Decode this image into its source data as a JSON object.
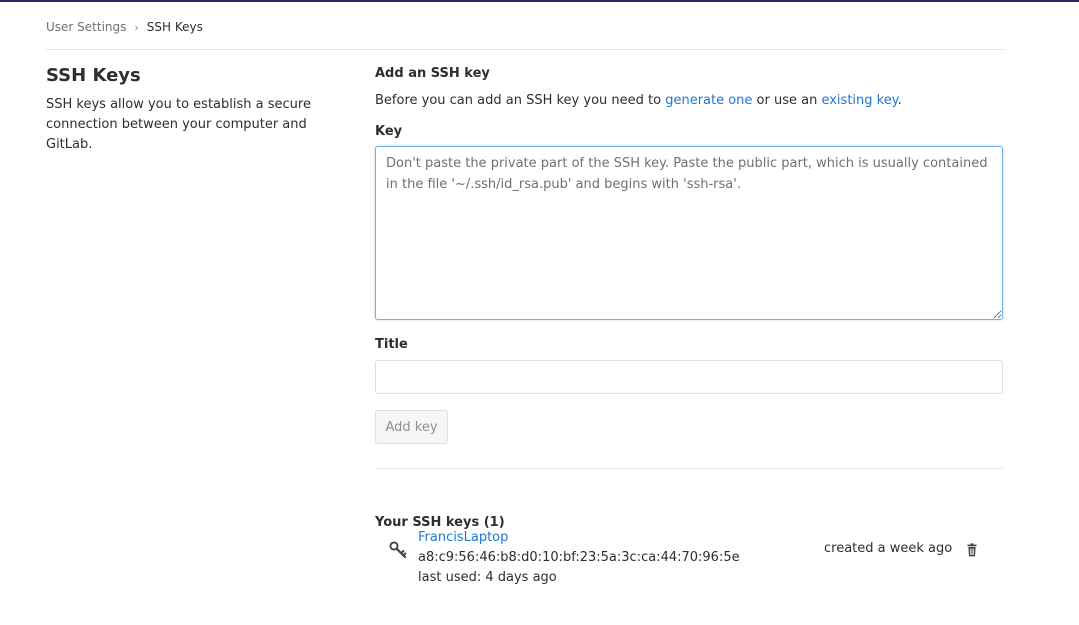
{
  "breadcrumb": {
    "parent": "User Settings",
    "separator_icon": "chevron-right-icon",
    "current": "SSH Keys"
  },
  "sidebar": {
    "title": "SSH Keys",
    "description": "SSH keys allow you to establish a secure connection between your computer and GitLab."
  },
  "form": {
    "heading": "Add an SSH key",
    "intro_before": "Before you can add an SSH key you need to ",
    "intro_link1": "generate one",
    "intro_middle": " or use an ",
    "intro_link2": "existing key",
    "intro_after": ".",
    "key_label": "Key",
    "key_placeholder": "Don't paste the private part of the SSH key. Paste the public part, which is usually contained in the file '~/.ssh/id_rsa.pub' and begins with 'ssh-rsa'.",
    "key_value": "",
    "title_label": "Title",
    "title_value": "",
    "title_placeholder": "",
    "submit_label": "Add key"
  },
  "keys_list": {
    "heading": "Your SSH keys (1)",
    "items": [
      {
        "title": "FrancisLaptop",
        "fingerprint": "a8:c9:56:46:b8:d0:10:bf:23:5a:3c:ca:44:70:96:5e",
        "last_used": "last used: 4 days ago",
        "created": "created a week ago",
        "icon": "key-icon",
        "remove_icon": "trash-icon"
      }
    ]
  },
  "colors": {
    "top_bar": "#292961",
    "link": "#1f78d1",
    "focus_border": "#73afea"
  }
}
